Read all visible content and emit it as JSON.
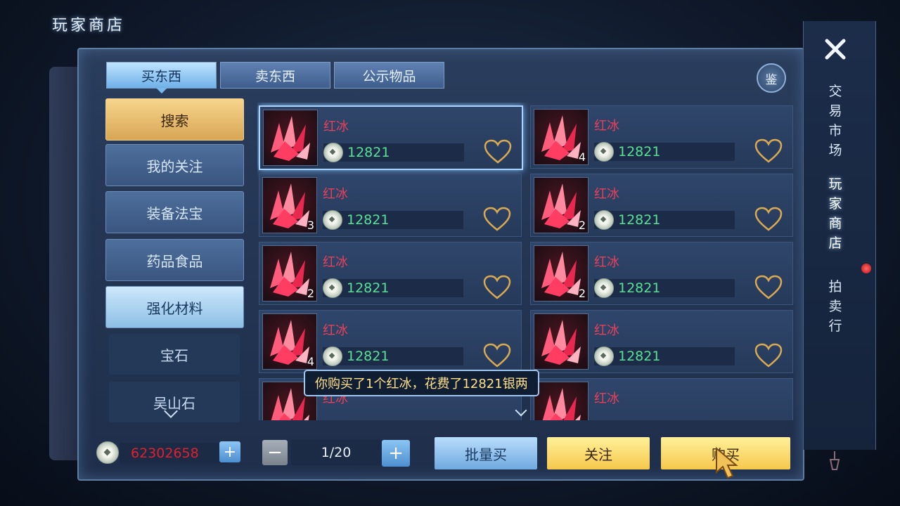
{
  "header": {
    "title": "玩家商店"
  },
  "tabs": [
    {
      "label": "买东西",
      "active": true
    },
    {
      "label": "卖东西",
      "active": false
    },
    {
      "label": "公示物品",
      "active": false
    }
  ],
  "appraise_label": "鉴",
  "categories": [
    {
      "label": "搜索",
      "style": "search"
    },
    {
      "label": "我的关注",
      "style": "normal"
    },
    {
      "label": "装备法宝",
      "style": "normal"
    },
    {
      "label": "药品食品",
      "style": "normal"
    },
    {
      "label": "强化材料",
      "style": "selected"
    },
    {
      "label": "宝石",
      "style": "sub"
    },
    {
      "label": "吴山石",
      "style": "sub"
    }
  ],
  "items": [
    {
      "name": "红冰",
      "price": "12821",
      "quantity": "",
      "highlighted": true
    },
    {
      "name": "红冰",
      "price": "12821",
      "quantity": "4"
    },
    {
      "name": "红冰",
      "price": "12821",
      "quantity": "3"
    },
    {
      "name": "红冰",
      "price": "12821",
      "quantity": "2"
    },
    {
      "name": "红冰",
      "price": "12821",
      "quantity": "2"
    },
    {
      "name": "红冰",
      "price": "12821",
      "quantity": "2"
    },
    {
      "name": "红冰",
      "price": "12821",
      "quantity": "4"
    },
    {
      "name": "红冰",
      "price": "12821",
      "quantity": ""
    },
    {
      "name": "红冰",
      "price": "",
      "quantity": ""
    },
    {
      "name": "红冰",
      "price": "",
      "quantity": ""
    }
  ],
  "toast": "你购买了1个红冰，花费了12821银两",
  "footer": {
    "balance": "62302658",
    "page": "1/20",
    "bulk_buy": "批量买",
    "follow": "关注",
    "buy": "购买"
  },
  "side_nav": {
    "tabs": [
      {
        "label": "交\n易\n市\n场",
        "active": false
      },
      {
        "label": "玩\n家\n商\n店",
        "active": true
      },
      {
        "label": "拍\n卖\n行",
        "active": false
      }
    ]
  },
  "icons": {
    "close": "close-icon",
    "coin": "silver-coin-icon",
    "heart": "heart-icon",
    "item": "red-ice-crystal-icon"
  },
  "colors": {
    "item_name": "#e9405a",
    "price": "#59e095",
    "balance": "#e0202e",
    "toast_text": "#ffe08a"
  }
}
